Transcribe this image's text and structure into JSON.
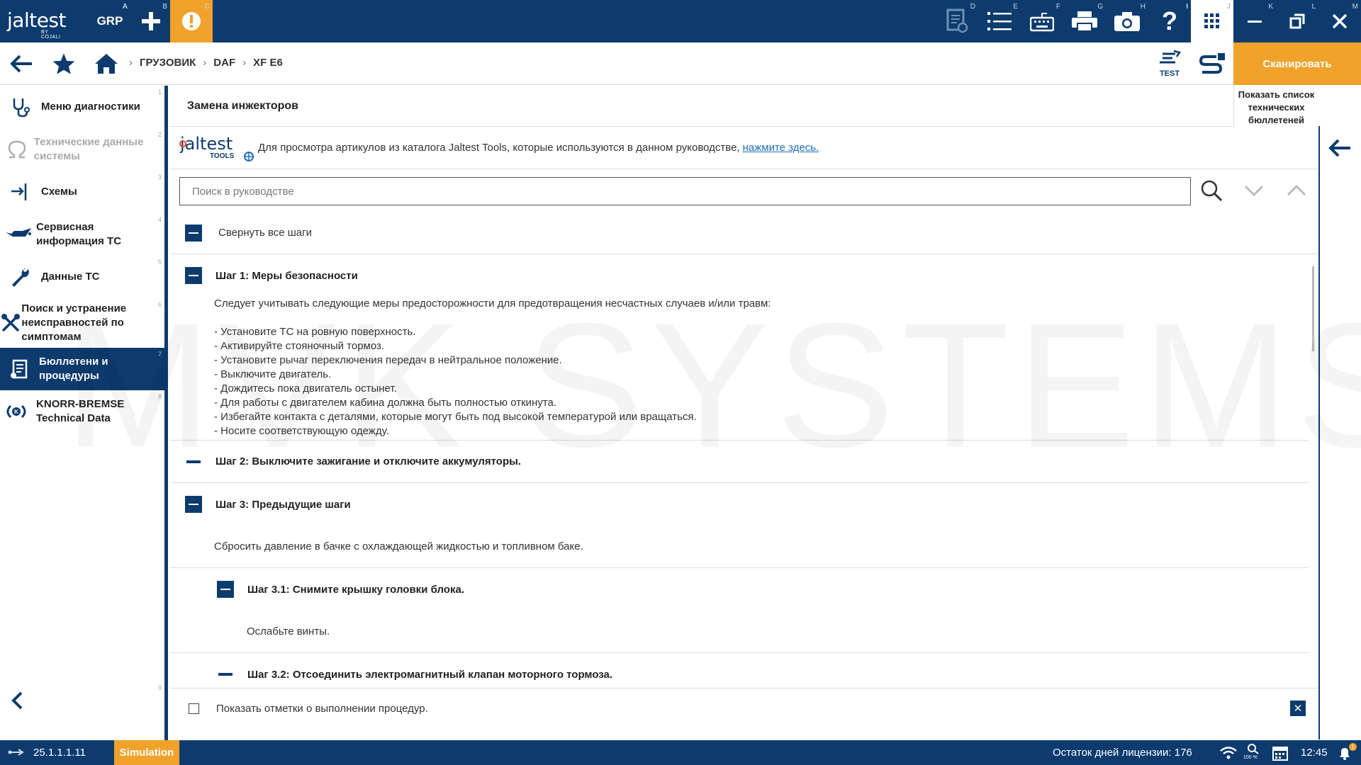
{
  "app": {
    "logo_main": "jaltest",
    "logo_sub": "BY COJALI"
  },
  "topbar": {
    "grp_label": "GRP",
    "keys": {
      "grp": "A",
      "plus": "B",
      "alert": "C",
      "docs": "D",
      "list": "E",
      "keyboard": "F",
      "print": "G",
      "camera": "H",
      "help": "I",
      "apps": "J",
      "minimize": "K",
      "restore": "L",
      "close": "M"
    }
  },
  "breadcrumb": {
    "items": [
      "ГРУЗОВИК",
      "DAF",
      "XF E6"
    ]
  },
  "navbar": {
    "test_label": "TEST",
    "scan_label": "Сканировать"
  },
  "sidebar": {
    "items": [
      {
        "label": "Меню диагностики",
        "num": "1",
        "icon": "stethoscope-icon"
      },
      {
        "label": "Технические данные системы",
        "num": "2",
        "icon": "omega-icon"
      },
      {
        "label": "Схемы",
        "num": "3",
        "icon": "diagram-icon"
      },
      {
        "label": "Сервисная информация ТС",
        "num": "4",
        "icon": "oil-can-icon"
      },
      {
        "label": "Данные ТС",
        "num": "5",
        "icon": "wrench-icon"
      },
      {
        "label": "Поиск и устранение неисправностей по симптомам",
        "num": "6",
        "icon": "tools-icon"
      },
      {
        "label": "Бюллетени и процедуры",
        "num": "7",
        "icon": "bulletin-icon"
      },
      {
        "label": "KNORR-BREMSE Technical Data",
        "num": "8",
        "icon": "knorr-icon"
      }
    ],
    "bottom_num": "9"
  },
  "content": {
    "title": "Замена инжекторов",
    "bulletins_button": "Показать список технических бюллетеней",
    "tools_logo_main": "jaltest",
    "tools_logo_sub": "TOOLS",
    "tools_text": "Для просмотра артикулов из каталога Jaltest Tools, которые используются в данном руководстве,",
    "tools_link": "нажмите здесь.",
    "search_placeholder": "Поиск в руководстве",
    "collapse_all": "Свернуть все шаги",
    "step1": {
      "title": "Шаг 1: Меры безопасности",
      "intro": "Следует учитывать следующие меры предосторожности для предотвращения несчастных случаев и/или травм:",
      "items": [
        "- Установите ТС на ровную поверхность.",
        "- Активируйте стояночный тормоз.",
        "- Установите рычаг переключения передач в нейтральное положение.",
        "- Выключите двигатель.",
        "- Дождитесь пока двигатель остынет.",
        "- Для работы с двигателем кабина должна быть полностью откинута.",
        "- Избегайте контакта с деталями, которые могут быть под высокой температурой или вращаться.",
        "- Носите соответствующую одежду."
      ]
    },
    "step2": {
      "title": "Шаг 2: Выключите зажигание и отключите аккумуляторы."
    },
    "step3": {
      "title": "Шаг 3: Предыдущие шаги",
      "body": "Сбросить давление в бачке с охлаждающей жидкостью и топливном баке."
    },
    "step3_1": {
      "title": "Шаг 3.1: Снимите крышку головки блока.",
      "body": "Ослабьте винты."
    },
    "step3_2": {
      "title": "Шаг 3.2: Отсоединить электромагнитный клапан моторного тормоза."
    },
    "footer_checkbox": "Показать отметки о выполнении процедур."
  },
  "statusbar": {
    "version": "25.1.1.1.11",
    "mode": "Simulation",
    "license": "Остаток дней лицензии: 176",
    "zoom": "100 %",
    "time": "12:45",
    "notification_count": "1"
  },
  "watermark": "MVK SYSTEMS",
  "colors": {
    "primary": "#0d3b6e",
    "accent": "#f0a22b",
    "link": "#1f6fb8"
  }
}
